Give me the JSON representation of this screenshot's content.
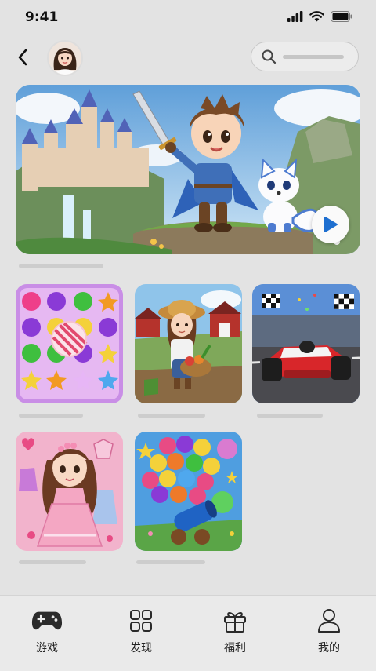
{
  "status_bar": {
    "time": "9:41"
  },
  "header": {
    "back_icon": "chevron-left-icon",
    "avatar": "user-avatar",
    "search_icon": "search-icon"
  },
  "banner": {
    "play_icon": "play-icon"
  },
  "games": [
    {
      "icon": "candy-match-game"
    },
    {
      "icon": "farm-game"
    },
    {
      "icon": "racing-game"
    },
    {
      "icon": "dress-up-game"
    },
    {
      "icon": "bubble-shooter-game"
    }
  ],
  "tabbar": {
    "tabs": [
      {
        "label": "游戏",
        "icon": "gamepad-icon",
        "active": true
      },
      {
        "label": "发现",
        "icon": "grid-icon"
      },
      {
        "label": "福利",
        "icon": "gift-icon"
      },
      {
        "label": "我的",
        "icon": "person-icon"
      }
    ]
  },
  "colors": {
    "accent": "#1e6fd0",
    "background": "#e3e3e3"
  }
}
